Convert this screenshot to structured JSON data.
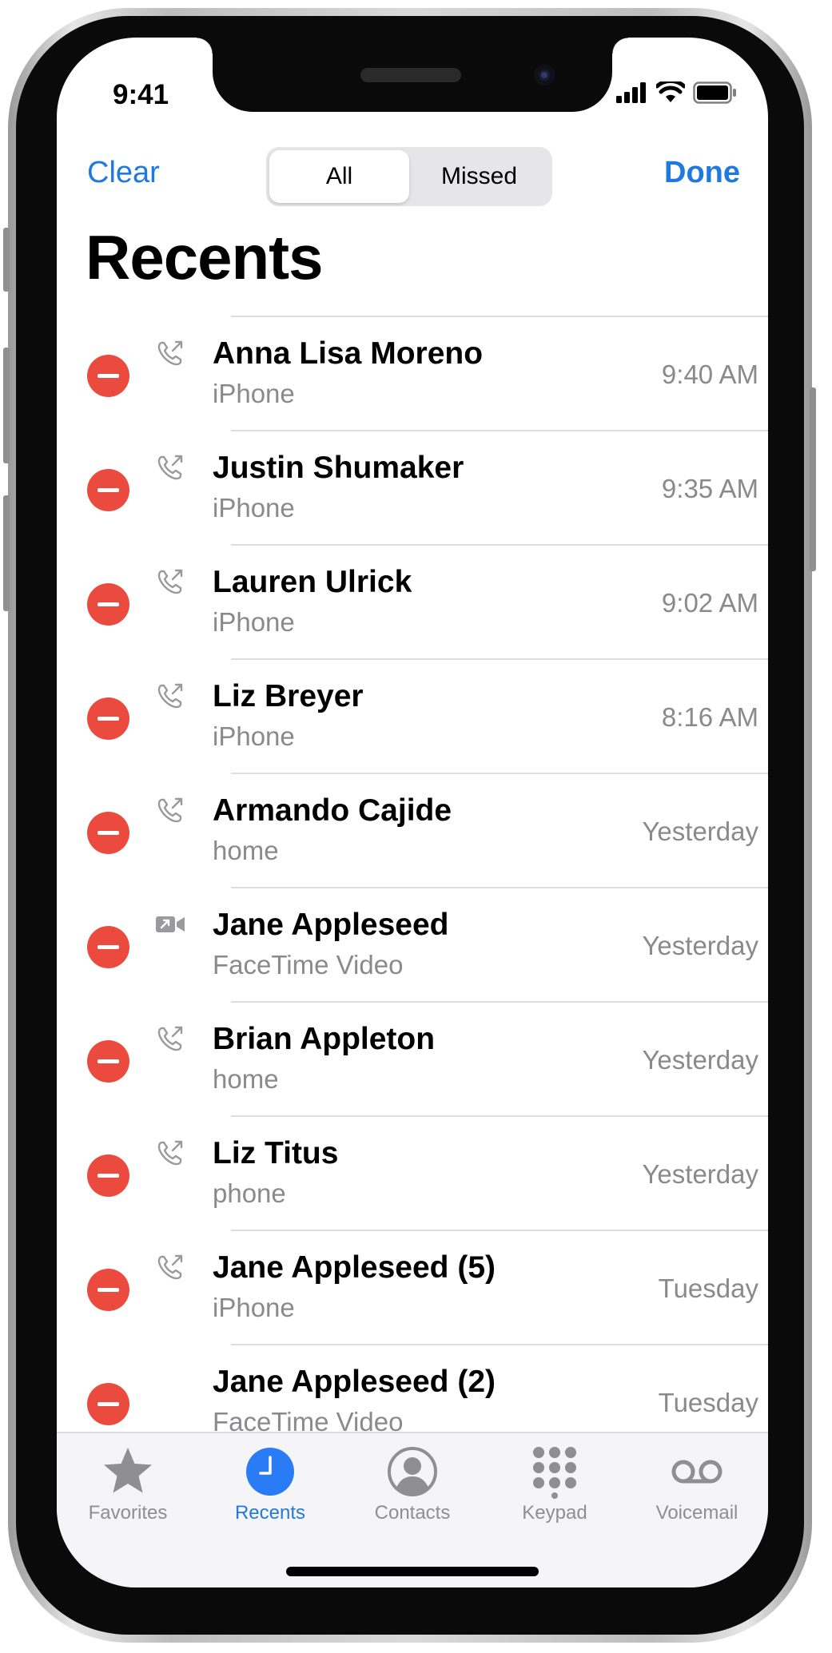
{
  "status": {
    "time": "9:41"
  },
  "nav": {
    "clear": "Clear",
    "done": "Done"
  },
  "segments": [
    {
      "label": "All",
      "active": true
    },
    {
      "label": "Missed",
      "active": false
    }
  ],
  "title": "Recents",
  "calls": [
    {
      "name": "Anna Lisa Moreno",
      "type": "iPhone",
      "time": "9:40 AM",
      "icon": "outgoing-call-icon"
    },
    {
      "name": "Justin Shumaker",
      "type": "iPhone",
      "time": "9:35 AM",
      "icon": "outgoing-call-icon"
    },
    {
      "name": "Lauren Ulrick",
      "type": "iPhone",
      "time": "9:02 AM",
      "icon": "outgoing-call-icon"
    },
    {
      "name": "Liz Breyer",
      "type": "iPhone",
      "time": "8:16 AM",
      "icon": "outgoing-call-icon"
    },
    {
      "name": "Armando Cajide",
      "type": "home",
      "time": "Yesterday",
      "icon": "outgoing-call-icon"
    },
    {
      "name": "Jane Appleseed",
      "type": "FaceTime Video",
      "time": "Yesterday",
      "icon": "outgoing-video-icon"
    },
    {
      "name": "Brian Appleton",
      "type": "home",
      "time": "Yesterday",
      "icon": "outgoing-call-icon"
    },
    {
      "name": "Liz Titus",
      "type": "phone",
      "time": "Yesterday",
      "icon": "outgoing-call-icon"
    },
    {
      "name": "Jane Appleseed (5)",
      "type": "iPhone",
      "time": "Tuesday",
      "icon": "outgoing-call-icon"
    },
    {
      "name": "Jane Appleseed (2)",
      "type": "FaceTime Video",
      "time": "Tuesday",
      "icon": "none"
    }
  ],
  "tabs": [
    {
      "label": "Favorites",
      "icon": "star-icon",
      "active": false
    },
    {
      "label": "Recents",
      "icon": "clock-icon",
      "active": true
    },
    {
      "label": "Contacts",
      "icon": "person-circle-icon",
      "active": false
    },
    {
      "label": "Keypad",
      "icon": "keypad-icon",
      "active": false
    },
    {
      "label": "Voicemail",
      "icon": "voicemail-icon",
      "active": false
    }
  ],
  "colors": {
    "accent": "#1f7ae0",
    "delete": "#eb4a3e",
    "secondary_text": "#8a8a8e"
  }
}
